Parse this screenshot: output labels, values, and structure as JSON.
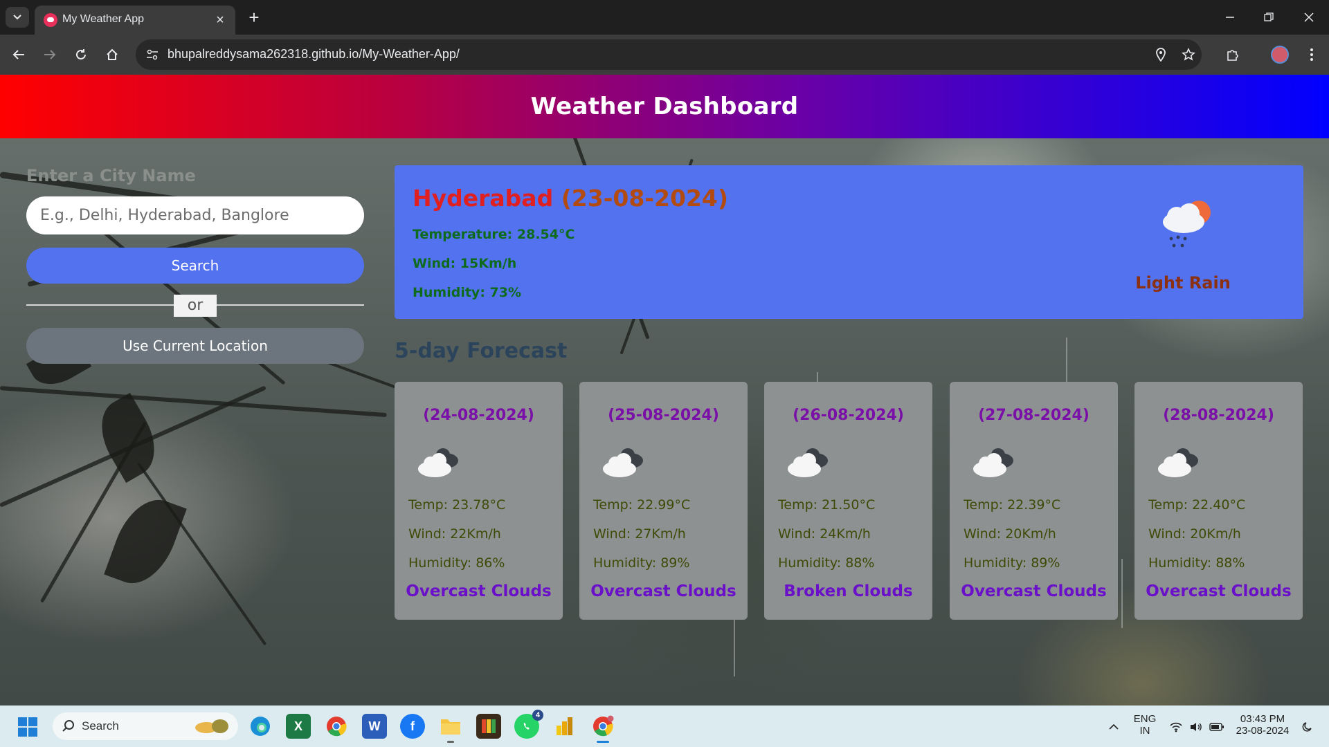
{
  "browser": {
    "tab_title": "My Weather App",
    "url": "bhupalreddysama262318.github.io/My-Weather-App/"
  },
  "header": {
    "title": "Weather Dashboard"
  },
  "search": {
    "label": "Enter a City Name",
    "placeholder": "E.g., Delhi, Hyderabad, Banglore",
    "search_button": "Search",
    "or_text": "or",
    "location_button": "Use Current Location"
  },
  "current": {
    "city": "Hyderabad",
    "date": "(23-08-2024)",
    "temperature": "Temperature: 28.54°C",
    "wind": "Wind: 15Km/h",
    "humidity": "Humidity: 73%",
    "description": "Light Rain",
    "icon": "rain-cloud-sun-icon"
  },
  "forecast": {
    "title": "5-day Forecast",
    "days": [
      {
        "date": "(24-08-2024)",
        "temp": "Temp: 23.78°C",
        "wind": "Wind: 22Km/h",
        "humidity": "Humidity: 86%",
        "description": "Overcast Clouds",
        "icon": "overcast-clouds-icon"
      },
      {
        "date": "(25-08-2024)",
        "temp": "Temp: 22.99°C",
        "wind": "Wind: 27Km/h",
        "humidity": "Humidity: 89%",
        "description": "Overcast Clouds",
        "icon": "overcast-clouds-icon"
      },
      {
        "date": "(26-08-2024)",
        "temp": "Temp: 21.50°C",
        "wind": "Wind: 24Km/h",
        "humidity": "Humidity: 88%",
        "description": "Broken Clouds",
        "icon": "broken-clouds-icon"
      },
      {
        "date": "(27-08-2024)",
        "temp": "Temp: 22.39°C",
        "wind": "Wind: 20Km/h",
        "humidity": "Humidity: 89%",
        "description": "Overcast Clouds",
        "icon": "overcast-clouds-icon"
      },
      {
        "date": "(28-08-2024)",
        "temp": "Temp: 22.40°C",
        "wind": "Wind: 20Km/h",
        "humidity": "Humidity: 88%",
        "description": "Overcast Clouds",
        "icon": "overcast-clouds-icon"
      }
    ]
  },
  "taskbar": {
    "search_label": "Search",
    "whatsapp_badge": "4",
    "lang_top": "ENG",
    "lang_bottom": "IN",
    "time": "03:43 PM",
    "date": "23-08-2024"
  },
  "colors": {
    "header_gradient": [
      "#ff0000",
      "#6a00a6",
      "#0000ff"
    ],
    "accent": "#5372f0",
    "location_button": "#6c757d",
    "card": "#8e9192"
  }
}
